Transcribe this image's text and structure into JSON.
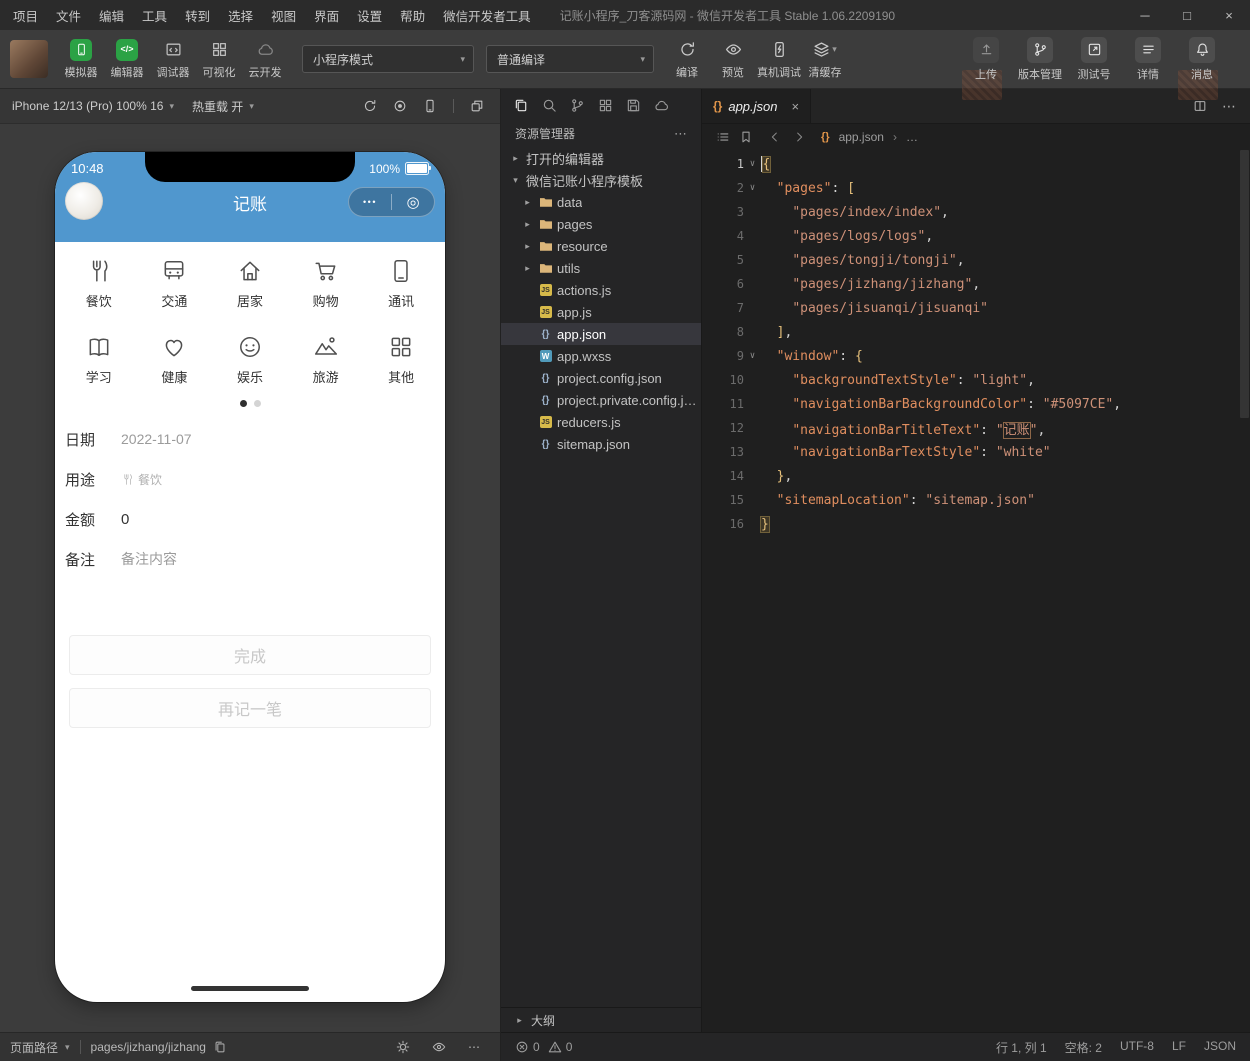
{
  "titlebar": {
    "menus": [
      "项目",
      "文件",
      "编辑",
      "工具",
      "转到",
      "选择",
      "视图",
      "界面",
      "设置",
      "帮助",
      "微信开发者工具"
    ],
    "title": "记账小程序_刀客源码网 - 微信开发者工具 Stable 1.06.2209190"
  },
  "toolbar": {
    "left_tools": [
      {
        "label": "模拟器",
        "icon": "simulator",
        "style": "green"
      },
      {
        "label": "编辑器",
        "icon": "editor",
        "style": "green"
      },
      {
        "label": "调试器",
        "icon": "debugger",
        "style": "plain"
      },
      {
        "label": "可视化",
        "icon": "visual",
        "style": "plain"
      },
      {
        "label": "云开发",
        "icon": "cloud",
        "style": "dim"
      }
    ],
    "mode_select": "小程序模式",
    "compile_select": "普通编译",
    "compile_actions": [
      {
        "label": "编译",
        "icon": "compile"
      },
      {
        "label": "预览",
        "icon": "eye"
      },
      {
        "label": "真机调试",
        "icon": "device-debug"
      },
      {
        "label": "清缓存",
        "icon": "clear-cache",
        "caret": true
      }
    ],
    "right_tools": [
      {
        "label": "上传",
        "icon": "upload",
        "dim": true
      },
      {
        "label": "版本管理",
        "icon": "version"
      },
      {
        "label": "测试号",
        "icon": "testid"
      },
      {
        "label": "详情",
        "icon": "details"
      },
      {
        "label": "消息",
        "icon": "message"
      }
    ]
  },
  "simulator": {
    "device_label": "iPhone 12/13 (Pro) 100% 16",
    "hot_reload_label": "热重载 开",
    "device_icons": [
      "refresh",
      "record",
      "phone",
      "|",
      "multi-window"
    ],
    "path_label": "页面路径",
    "path_value": "pages/jizhang/jizhang",
    "path_icons": [
      "sun",
      "eye",
      "more"
    ]
  },
  "phone": {
    "time": "10:48",
    "battery": "100%",
    "nav_title": "记账",
    "nav_color": "#5097CE",
    "categories": [
      {
        "label": "餐饮",
        "icon": "dining"
      },
      {
        "label": "交通",
        "icon": "transport"
      },
      {
        "label": "居家",
        "icon": "home"
      },
      {
        "label": "购物",
        "icon": "shopping"
      },
      {
        "label": "通讯",
        "icon": "comms"
      },
      {
        "label": "学习",
        "icon": "study"
      },
      {
        "label": "健康",
        "icon": "health"
      },
      {
        "label": "娱乐",
        "icon": "fun"
      },
      {
        "label": "旅游",
        "icon": "travel"
      },
      {
        "label": "其他",
        "icon": "other"
      }
    ],
    "form": [
      {
        "label": "日期",
        "value": "2022-11-07",
        "cls": "muted"
      },
      {
        "label": "用途",
        "value": "餐饮",
        "cls": "small",
        "icon": "dining"
      },
      {
        "label": "金额",
        "value": "0",
        "cls": "strong"
      },
      {
        "label": "备注",
        "value": "备注内容",
        "cls": "muted"
      }
    ],
    "buttons": [
      "完成",
      "再记一笔"
    ]
  },
  "explorer": {
    "toolbar_icons": [
      "files",
      "search",
      "branch",
      "grid4",
      "save",
      "cloud"
    ],
    "title": "资源管理器",
    "tree": [
      {
        "label": "打开的编辑器",
        "type": "section",
        "chev": "r",
        "indent": 0
      },
      {
        "label": "微信记账小程序模板",
        "type": "section",
        "chev": "d",
        "indent": 0
      },
      {
        "label": "data",
        "type": "folder",
        "chev": "r",
        "indent": 1
      },
      {
        "label": "pages",
        "type": "folder",
        "chev": "r",
        "indent": 1
      },
      {
        "label": "resource",
        "type": "folder",
        "chev": "r",
        "indent": 1
      },
      {
        "label": "utils",
        "type": "folder",
        "chev": "r",
        "indent": 1
      },
      {
        "label": "actions.js",
        "type": "js",
        "indent": 1
      },
      {
        "label": "app.js",
        "type": "js",
        "indent": 1
      },
      {
        "label": "app.json",
        "type": "json",
        "indent": 1,
        "selected": true
      },
      {
        "label": "app.wxss",
        "type": "wxss",
        "indent": 1
      },
      {
        "label": "project.config.json",
        "type": "json",
        "indent": 1
      },
      {
        "label": "project.private.config.js…",
        "type": "json",
        "indent": 1
      },
      {
        "label": "reducers.js",
        "type": "js",
        "indent": 1
      },
      {
        "label": "sitemap.json",
        "type": "json",
        "indent": 1
      }
    ],
    "outline_label": "大纲"
  },
  "editor": {
    "tab_label": "app.json",
    "breadcrumb_file": "app.json",
    "breadcrumb_sep": "›",
    "breadcrumb_more": "…",
    "code_lines": [
      {
        "n": 1,
        "fold": true,
        "seg": [
          [
            "brm",
            "{"
          ]
        ]
      },
      {
        "n": 2,
        "fold": true,
        "seg": [
          [
            "pl",
            "  "
          ],
          [
            "key",
            "\"pages\""
          ],
          [
            "pl",
            ": "
          ],
          [
            "br",
            "["
          ]
        ]
      },
      {
        "n": 3,
        "seg": [
          [
            "pl",
            "    "
          ],
          [
            "str",
            "\"pages/index/index\""
          ],
          [
            "pl",
            ","
          ]
        ]
      },
      {
        "n": 4,
        "seg": [
          [
            "pl",
            "    "
          ],
          [
            "str",
            "\"pages/logs/logs\""
          ],
          [
            "pl",
            ","
          ]
        ]
      },
      {
        "n": 5,
        "seg": [
          [
            "pl",
            "    "
          ],
          [
            "str",
            "\"pages/tongji/tongji\""
          ],
          [
            "pl",
            ","
          ]
        ]
      },
      {
        "n": 6,
        "seg": [
          [
            "pl",
            "    "
          ],
          [
            "str",
            "\"pages/jizhang/jizhang\""
          ],
          [
            "pl",
            ","
          ]
        ]
      },
      {
        "n": 7,
        "seg": [
          [
            "pl",
            "    "
          ],
          [
            "str",
            "\"pages/jisuanqi/jisuanqi\""
          ]
        ]
      },
      {
        "n": 8,
        "seg": [
          [
            "pl",
            "  "
          ],
          [
            "br",
            "]"
          ],
          [
            "pl",
            ","
          ]
        ]
      },
      {
        "n": 9,
        "fold": true,
        "seg": [
          [
            "pl",
            "  "
          ],
          [
            "key",
            "\"window\""
          ],
          [
            "pl",
            ": "
          ],
          [
            "br",
            "{"
          ]
        ]
      },
      {
        "n": 10,
        "seg": [
          [
            "pl",
            "    "
          ],
          [
            "key",
            "\"backgroundTextStyle\""
          ],
          [
            "pl",
            ": "
          ],
          [
            "str",
            "\"light\""
          ],
          [
            "pl",
            ","
          ]
        ]
      },
      {
        "n": 11,
        "seg": [
          [
            "pl",
            "    "
          ],
          [
            "key",
            "\"navigationBarBackgroundColor\""
          ],
          [
            "pl",
            ": "
          ],
          [
            "str",
            "\"#5097CE\""
          ],
          [
            "pl",
            ","
          ]
        ]
      },
      {
        "n": 12,
        "seg": [
          [
            "pl",
            "    "
          ],
          [
            "key",
            "\"navigationBarTitleText\""
          ],
          [
            "pl",
            ": "
          ],
          [
            "str",
            "\""
          ],
          [
            "strbox",
            "记账"
          ],
          [
            "str",
            "\""
          ],
          [
            "pl",
            ","
          ]
        ]
      },
      {
        "n": 13,
        "seg": [
          [
            "pl",
            "    "
          ],
          [
            "key",
            "\"navigationBarTextStyle\""
          ],
          [
            "pl",
            ": "
          ],
          [
            "str",
            "\"white\""
          ]
        ]
      },
      {
        "n": 14,
        "seg": [
          [
            "pl",
            "  "
          ],
          [
            "br",
            "}"
          ],
          [
            "pl",
            ","
          ]
        ]
      },
      {
        "n": 15,
        "seg": [
          [
            "pl",
            "  "
          ],
          [
            "key",
            "\"sitemapLocation\""
          ],
          [
            "pl",
            ": "
          ],
          [
            "str",
            "\"sitemap.json\""
          ]
        ]
      },
      {
        "n": 16,
        "seg": [
          [
            "brm",
            "}"
          ]
        ]
      }
    ]
  },
  "statusbar": {
    "errors": "0",
    "warnings": "0",
    "cursor_pos": "行 1, 列 1",
    "indent": "空格: 2",
    "encoding": "UTF-8",
    "eol": "LF",
    "language": "JSON"
  }
}
